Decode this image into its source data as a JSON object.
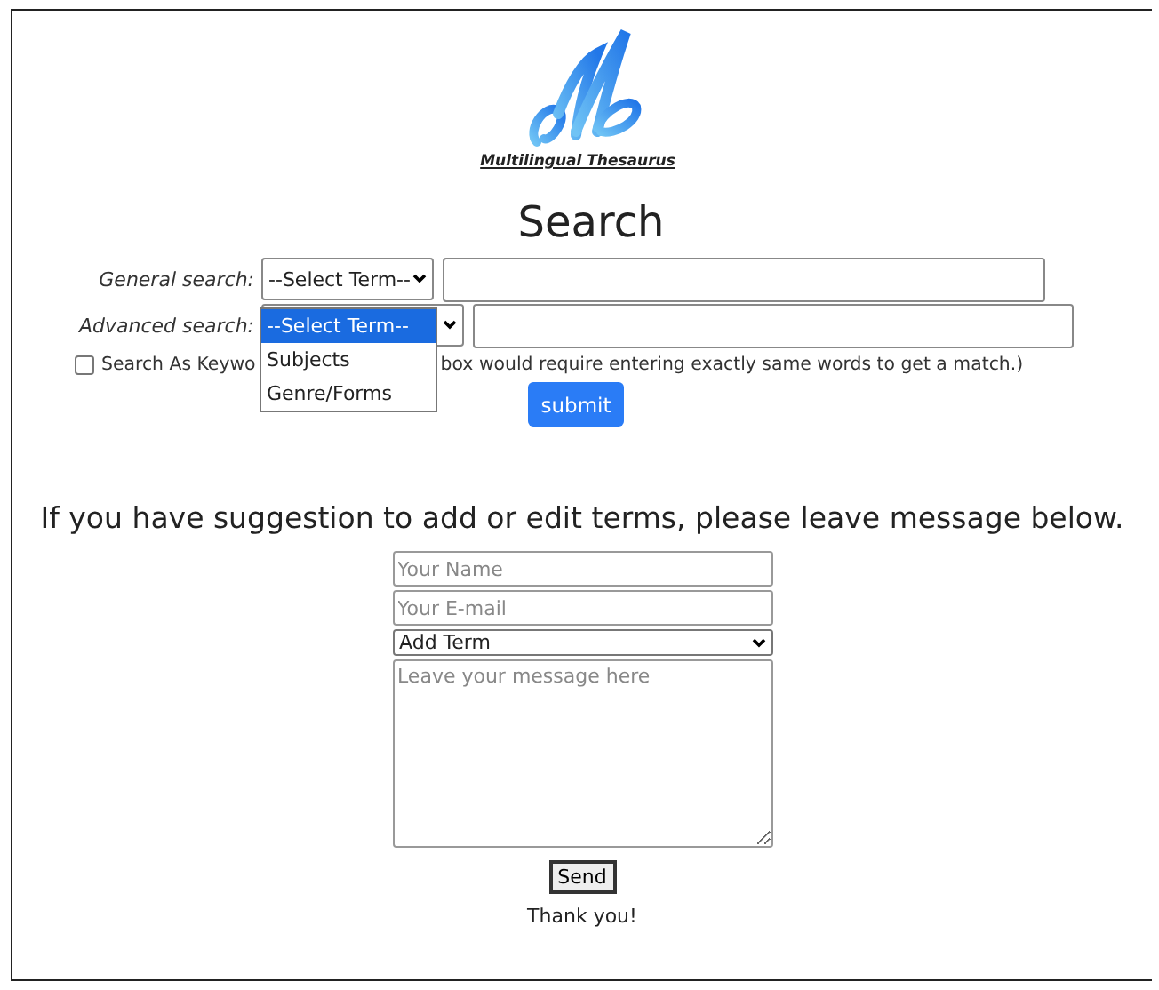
{
  "logo": {
    "caption": "Multilingual Thesaurus"
  },
  "heading": "Search",
  "general_search": {
    "label": "General search:",
    "select_value": "--Select Term--"
  },
  "advanced_search": {
    "label": "Advanced search:"
  },
  "dropdown": {
    "options": [
      {
        "label": "--Select Term--",
        "selected": true
      },
      {
        "label": "Subjects",
        "selected": false
      },
      {
        "label": "Genre/Forms",
        "selected": false
      }
    ]
  },
  "keyword_checkbox": {
    "checked": false,
    "label_before": "Search As Keywo",
    "label_after": "box would require entering exactly same words to get a match.)"
  },
  "submit": "submit",
  "suggestion": {
    "text": "If you have suggestion to add or edit terms, please leave message below.",
    "name_placeholder": "Your Name",
    "email_placeholder": "Your E-mail",
    "type_value": "Add Term",
    "message_placeholder": "Leave your message here",
    "send": "Send",
    "thanks": "Thank you!"
  }
}
